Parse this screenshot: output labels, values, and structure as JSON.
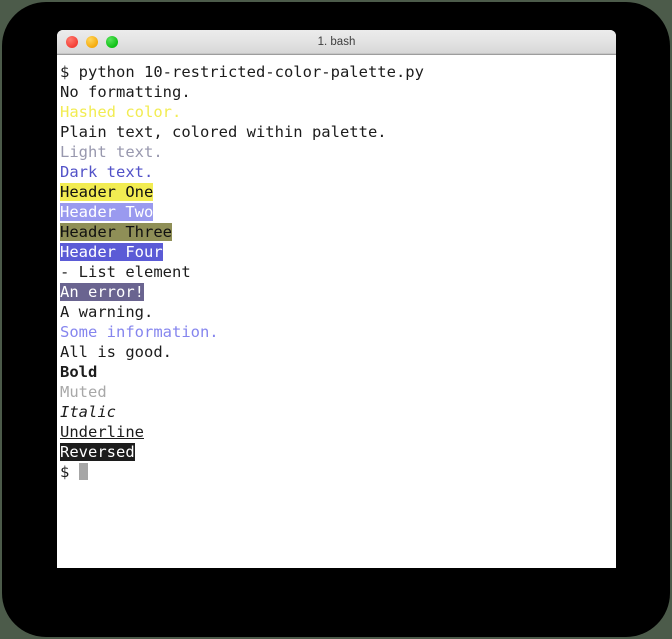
{
  "window": {
    "title": "1. bash",
    "controls": [
      {
        "name": "close",
        "label": "Close"
      },
      {
        "name": "minimize",
        "label": "Minimize"
      },
      {
        "name": "maximize",
        "label": "Maximize"
      }
    ]
  },
  "colors": {
    "desktop_background": "#4c5b4a",
    "backdrop": "#000000",
    "terminal_background": "#ffffff",
    "titlebar_top": "#ececec",
    "titlebar_bottom": "#b4b4b4",
    "plain_text": "#1c1c1c",
    "hashed_yellow": "#f2ec52",
    "light_text": "#9898ae",
    "dark_text": "#5252c8",
    "info_blue": "#8585ee",
    "muted_gray": "#a8a8a8",
    "header_one_bg": "#f2ec52",
    "header_two_bg": "#9a9aef",
    "header_three_bg": "#8f8f57",
    "header_four_bg": "#5b5bd6",
    "error_bg": "#6a6490",
    "reversed_bg": "#1c1c1c",
    "cursor": "#a6a6a6",
    "light_red": "#f43f36",
    "light_yellow": "#f5ab0d",
    "light_green": "#0fc015"
  },
  "terminal": {
    "lines": [
      {
        "id": "command-line",
        "text": "$ python 10-restricted-color-palette.py",
        "style": "plain"
      },
      {
        "id": "no-formatting",
        "text": "No formatting.",
        "style": "plain"
      },
      {
        "id": "hashed-color",
        "text": "Hashed color.",
        "style": "yellow"
      },
      {
        "id": "plain-colored",
        "text": "Plain text, colored within palette.",
        "style": "plain"
      },
      {
        "id": "light-text",
        "text": "Light text.",
        "style": "light"
      },
      {
        "id": "dark-text",
        "text": "Dark text.",
        "style": "dark"
      },
      {
        "id": "header-one",
        "text": "Header One",
        "style": "hl-h1"
      },
      {
        "id": "header-two",
        "text": "Header Two",
        "style": "hl-h2"
      },
      {
        "id": "header-three",
        "text": "Header Three",
        "style": "hl-h3"
      },
      {
        "id": "header-four",
        "text": "Header Four",
        "style": "hl-h4"
      },
      {
        "id": "list-element",
        "text": "- List element",
        "style": "plain"
      },
      {
        "id": "error-line",
        "text": "An error!",
        "style": "hl-err"
      },
      {
        "id": "warning-line",
        "text": "A warning.",
        "style": "plain"
      },
      {
        "id": "info-line",
        "text": "Some information.",
        "style": "info"
      },
      {
        "id": "success-line",
        "text": "All is good.",
        "style": "plain"
      },
      {
        "id": "bold-line",
        "text": "Bold",
        "style": "bold"
      },
      {
        "id": "muted-line",
        "text": "Muted",
        "style": "muted"
      },
      {
        "id": "italic-line",
        "text": "Italic",
        "style": "italic"
      },
      {
        "id": "underline-line",
        "text": "Underline",
        "style": "underline"
      },
      {
        "id": "reversed-line",
        "text": "Reversed",
        "style": "hl-rev"
      }
    ],
    "prompt": "$ "
  }
}
